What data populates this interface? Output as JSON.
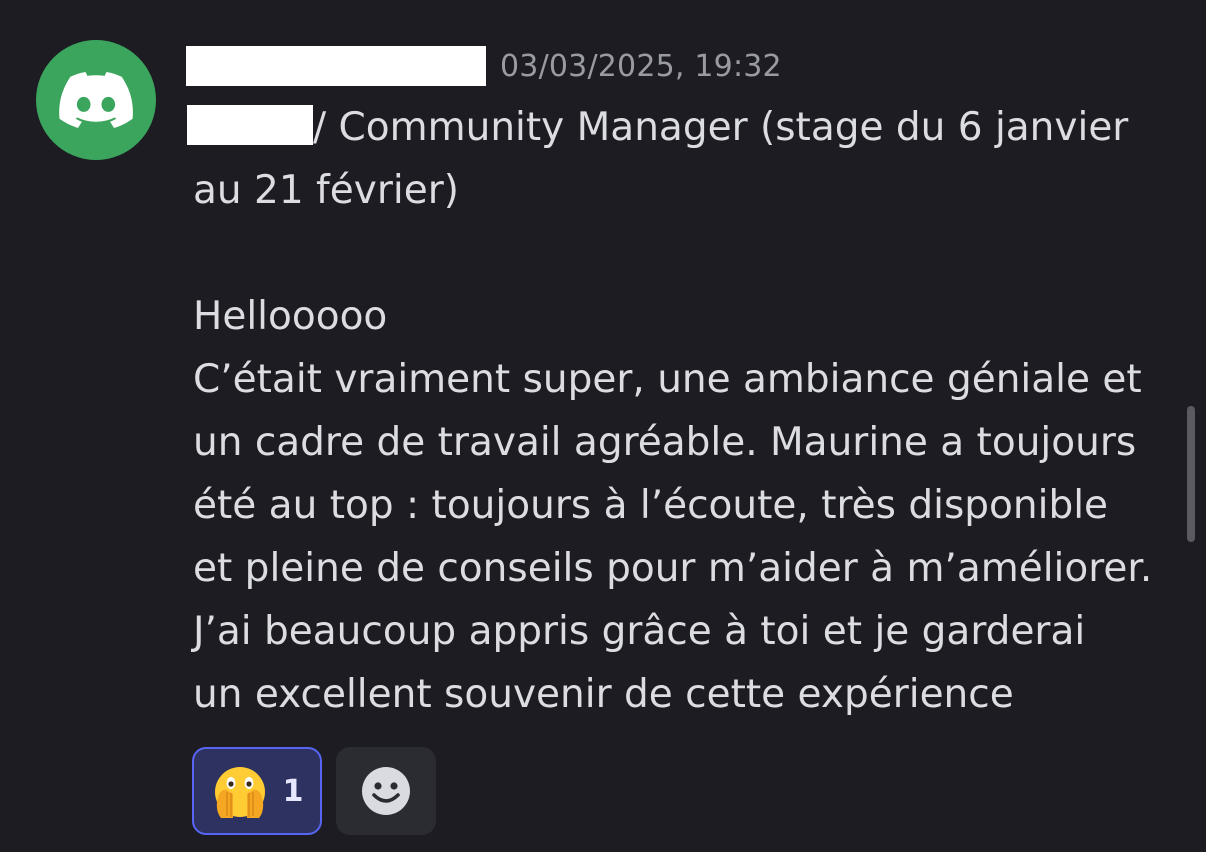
{
  "message": {
    "timestamp": "03/03/2025, 19:32",
    "role_line": "/ Community Manager (stage du 6 janvier",
    "role_line_2": "au 21 février)",
    "lines": [
      "Hellooooo",
      "C’était vraiment super, une ambiance géniale et",
      "un cadre de travail agréable. Maurine a toujours",
      "été au top : toujours à l’écoute, très disponible",
      "et pleine de conseils pour m’aider à m’améliorer.",
      "J’ai beaucoup appris grâce à toi et je garderai",
      "un excellent souvenir de cette expérience"
    ]
  },
  "reactions": [
    {
      "emoji": "face-with-open-eyes-and-hand-over-mouth",
      "count": "1"
    }
  ],
  "colors": {
    "background": "#1c1c22",
    "avatar": "#3ba55d",
    "accent": "#5865f2",
    "text": "#dcdde1",
    "muted": "#9a9aa3"
  }
}
